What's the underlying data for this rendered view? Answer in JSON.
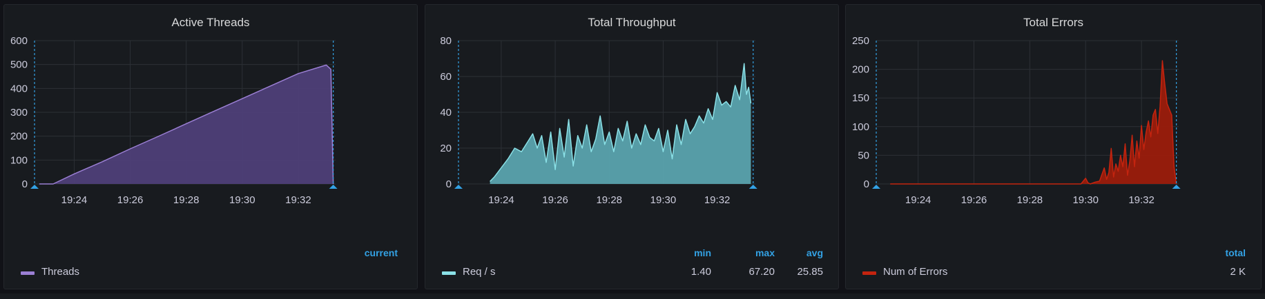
{
  "panels": [
    {
      "title": "Active Threads",
      "legend": {
        "headers": [
          "current"
        ],
        "series_label": "Threads",
        "values": []
      },
      "colors": {
        "line": "#9b7fd4",
        "fill": "#4e3f78"
      },
      "chart_data": {
        "type": "area",
        "title": "Active Threads",
        "ylim": [
          0,
          600
        ],
        "yticks": [
          "0",
          "100",
          "200",
          "300",
          "400",
          "500",
          "600"
        ],
        "xticks": [
          "19:24",
          "19:26",
          "19:28",
          "19:30",
          "19:32"
        ],
        "series": [
          {
            "name": "Threads",
            "x": [
              "19:22:45",
              "19:23:15",
              "19:24",
              "19:25",
              "19:26",
              "19:27",
              "19:28",
              "19:29",
              "19:30",
              "19:31",
              "19:32",
              "19:33",
              "19:33:10",
              "19:33:15"
            ],
            "values": [
              0,
              0,
              42,
              93,
              147,
              199,
              252,
              305,
              357,
              410,
              462,
              498,
              480,
              0
            ]
          }
        ]
      }
    },
    {
      "title": "Total Throughput",
      "legend": {
        "headers": [
          "min",
          "max",
          "avg"
        ],
        "series_label": "Req / s",
        "values": [
          "1.40",
          "67.20",
          "25.85"
        ]
      },
      "colors": {
        "line": "#8ae0e6",
        "fill": "#5aa3ae"
      },
      "chart_data": {
        "type": "area",
        "title": "Total Throughput",
        "ylim": [
          0,
          80
        ],
        "yticks": [
          "0",
          "20",
          "40",
          "60",
          "80"
        ],
        "xticks": [
          "19:24",
          "19:26",
          "19:28",
          "19:30",
          "19:32"
        ],
        "series": [
          {
            "name": "Req / s",
            "x": [
              "19:23:35",
              "19:23:45",
              "19:24",
              "19:24:15",
              "19:24:30",
              "19:24:45",
              "19:25",
              "19:25:10",
              "19:25:20",
              "19:25:30",
              "19:25:40",
              "19:25:50",
              "19:26",
              "19:26:10",
              "19:26:20",
              "19:26:30",
              "19:26:40",
              "19:26:50",
              "19:27",
              "19:27:10",
              "19:27:20",
              "19:27:30",
              "19:27:40",
              "19:27:50",
              "19:28",
              "19:28:10",
              "19:28:20",
              "19:28:30",
              "19:28:40",
              "19:28:50",
              "19:29",
              "19:29:10",
              "19:29:20",
              "19:29:30",
              "19:29:40",
              "19:29:50",
              "19:30",
              "19:30:10",
              "19:30:20",
              "19:30:30",
              "19:30:40",
              "19:30:50",
              "19:31",
              "19:31:10",
              "19:31:20",
              "19:31:30",
              "19:31:40",
              "19:31:50",
              "19:32",
              "19:32:10",
              "19:32:20",
              "19:32:30",
              "19:32:40",
              "19:32:50",
              "19:33",
              "19:33:05",
              "19:33:10",
              "19:33:15"
            ],
            "values": [
              1.4,
              4,
              9,
              14,
              20,
              18,
              24,
              28,
              20,
              27,
              12,
              29,
              8,
              31,
              15,
              36,
              10,
              27,
              20,
              33,
              18,
              25,
              38,
              22,
              29,
              18,
              31,
              24,
              35,
              20,
              28,
              22,
              33,
              26,
              24,
              31,
              18,
              30,
              14,
              33,
              22,
              36,
              28,
              32,
              38,
              34,
              42,
              36,
              51,
              44,
              46,
              43,
              55,
              47,
              67.2,
              50,
              54,
              45
            ]
          }
        ]
      }
    },
    {
      "title": "Total Errors",
      "legend": {
        "headers": [
          "total"
        ],
        "series_label": "Num of Errors",
        "values": [
          "2 K"
        ]
      },
      "colors": {
        "line": "#c4240f",
        "fill": "#9b1c0c"
      },
      "chart_data": {
        "type": "area",
        "title": "Total Errors",
        "ylim": [
          0,
          250
        ],
        "yticks": [
          "0",
          "50",
          "100",
          "150",
          "200",
          "250"
        ],
        "xticks": [
          "19:24",
          "19:26",
          "19:28",
          "19:30",
          "19:32"
        ],
        "series": [
          {
            "name": "Num of Errors",
            "x": [
              "19:23",
              "19:24",
              "19:25",
              "19:26",
              "19:27",
              "19:28",
              "19:29",
              "19:29:50",
              "19:30",
              "19:30:05",
              "19:30:10",
              "19:30:20",
              "19:30:30",
              "19:30:40",
              "19:30:45",
              "19:30:50",
              "19:30:55",
              "19:31",
              "19:31:05",
              "19:31:10",
              "19:31:15",
              "19:31:20",
              "19:31:25",
              "19:31:30",
              "19:31:35",
              "19:31:40",
              "19:31:45",
              "19:31:50",
              "19:31:55",
              "19:32",
              "19:32:05",
              "19:32:10",
              "19:32:15",
              "19:32:20",
              "19:32:25",
              "19:32:30",
              "19:32:35",
              "19:32:40",
              "19:32:45",
              "19:32:50",
              "19:32:55",
              "19:33",
              "19:33:05",
              "19:33:10",
              "19:33:15"
            ],
            "values": [
              0,
              0,
              0,
              0,
              0,
              0,
              0,
              0,
              10,
              2,
              0,
              3,
              5,
              28,
              8,
              20,
              62,
              12,
              35,
              22,
              50,
              30,
              70,
              15,
              40,
              85,
              30,
              75,
              45,
              102,
              60,
              90,
              110,
              82,
              120,
              130,
              88,
              135,
              215,
              175,
              140,
              130,
              120,
              30,
              0
            ]
          }
        ]
      }
    }
  ]
}
